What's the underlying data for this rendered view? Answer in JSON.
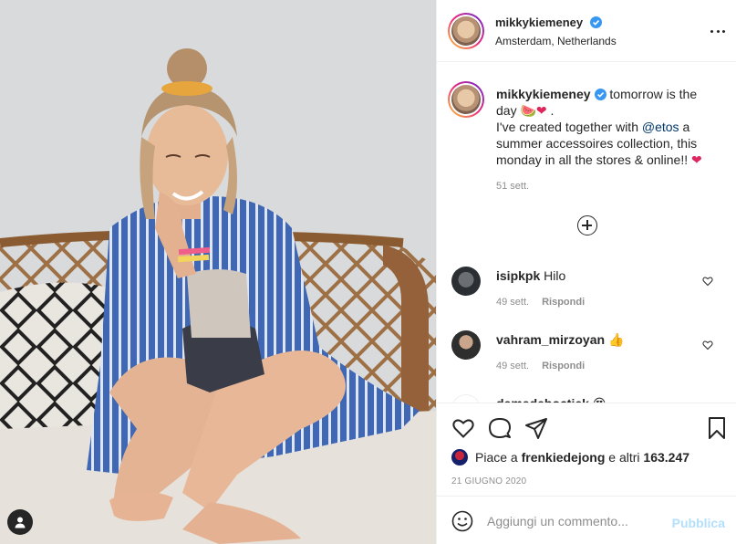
{
  "post": {
    "username": "mikkykiemeney",
    "location": "Amsterdam, Netherlands",
    "verified": true
  },
  "caption": {
    "username": "mikkykiemeney",
    "text_part1": "tomorrow is the day",
    "emoji_1": "🍉",
    "emoji_2": "❤",
    "text_part2": "I've created together with",
    "mention": "@etos",
    "text_part3": "a summer accessoires collection, this monday in all the stores & online!!",
    "emoji_3": "❤",
    "time": "51 sett."
  },
  "comments": [
    {
      "username": "isipkpk",
      "text": "Hilo",
      "time": "49 sett.",
      "reply": "Rispondi"
    },
    {
      "username": "vahram_mirzoyan",
      "text": "👍",
      "time": "49 sett.",
      "reply": "Rispondi"
    },
    {
      "username": "demedeboctiek",
      "text": "😍"
    }
  ],
  "likes": {
    "prefix": "Piace a",
    "user": "frenkiedejong",
    "middle": "e altri",
    "count": "163.247"
  },
  "date": "21 GIUGNO 2020",
  "add_comment": {
    "placeholder": "Aggiungi un commento...",
    "publish": "Pubblica"
  },
  "icons": {
    "options": "more-horizontal-icon",
    "like": "heart-icon",
    "comment": "comment-bubble-icon",
    "share": "paper-plane-icon",
    "save": "bookmark-icon",
    "emoji": "smiley-icon",
    "load_more": "plus-circle-icon",
    "user_tags": "user-tag-icon"
  },
  "colors": {
    "verified_blue": "#3897f0",
    "mention_blue": "#00376b",
    "publish_disabled": "#b2dffc",
    "muted_text": "#8e8e8e"
  }
}
